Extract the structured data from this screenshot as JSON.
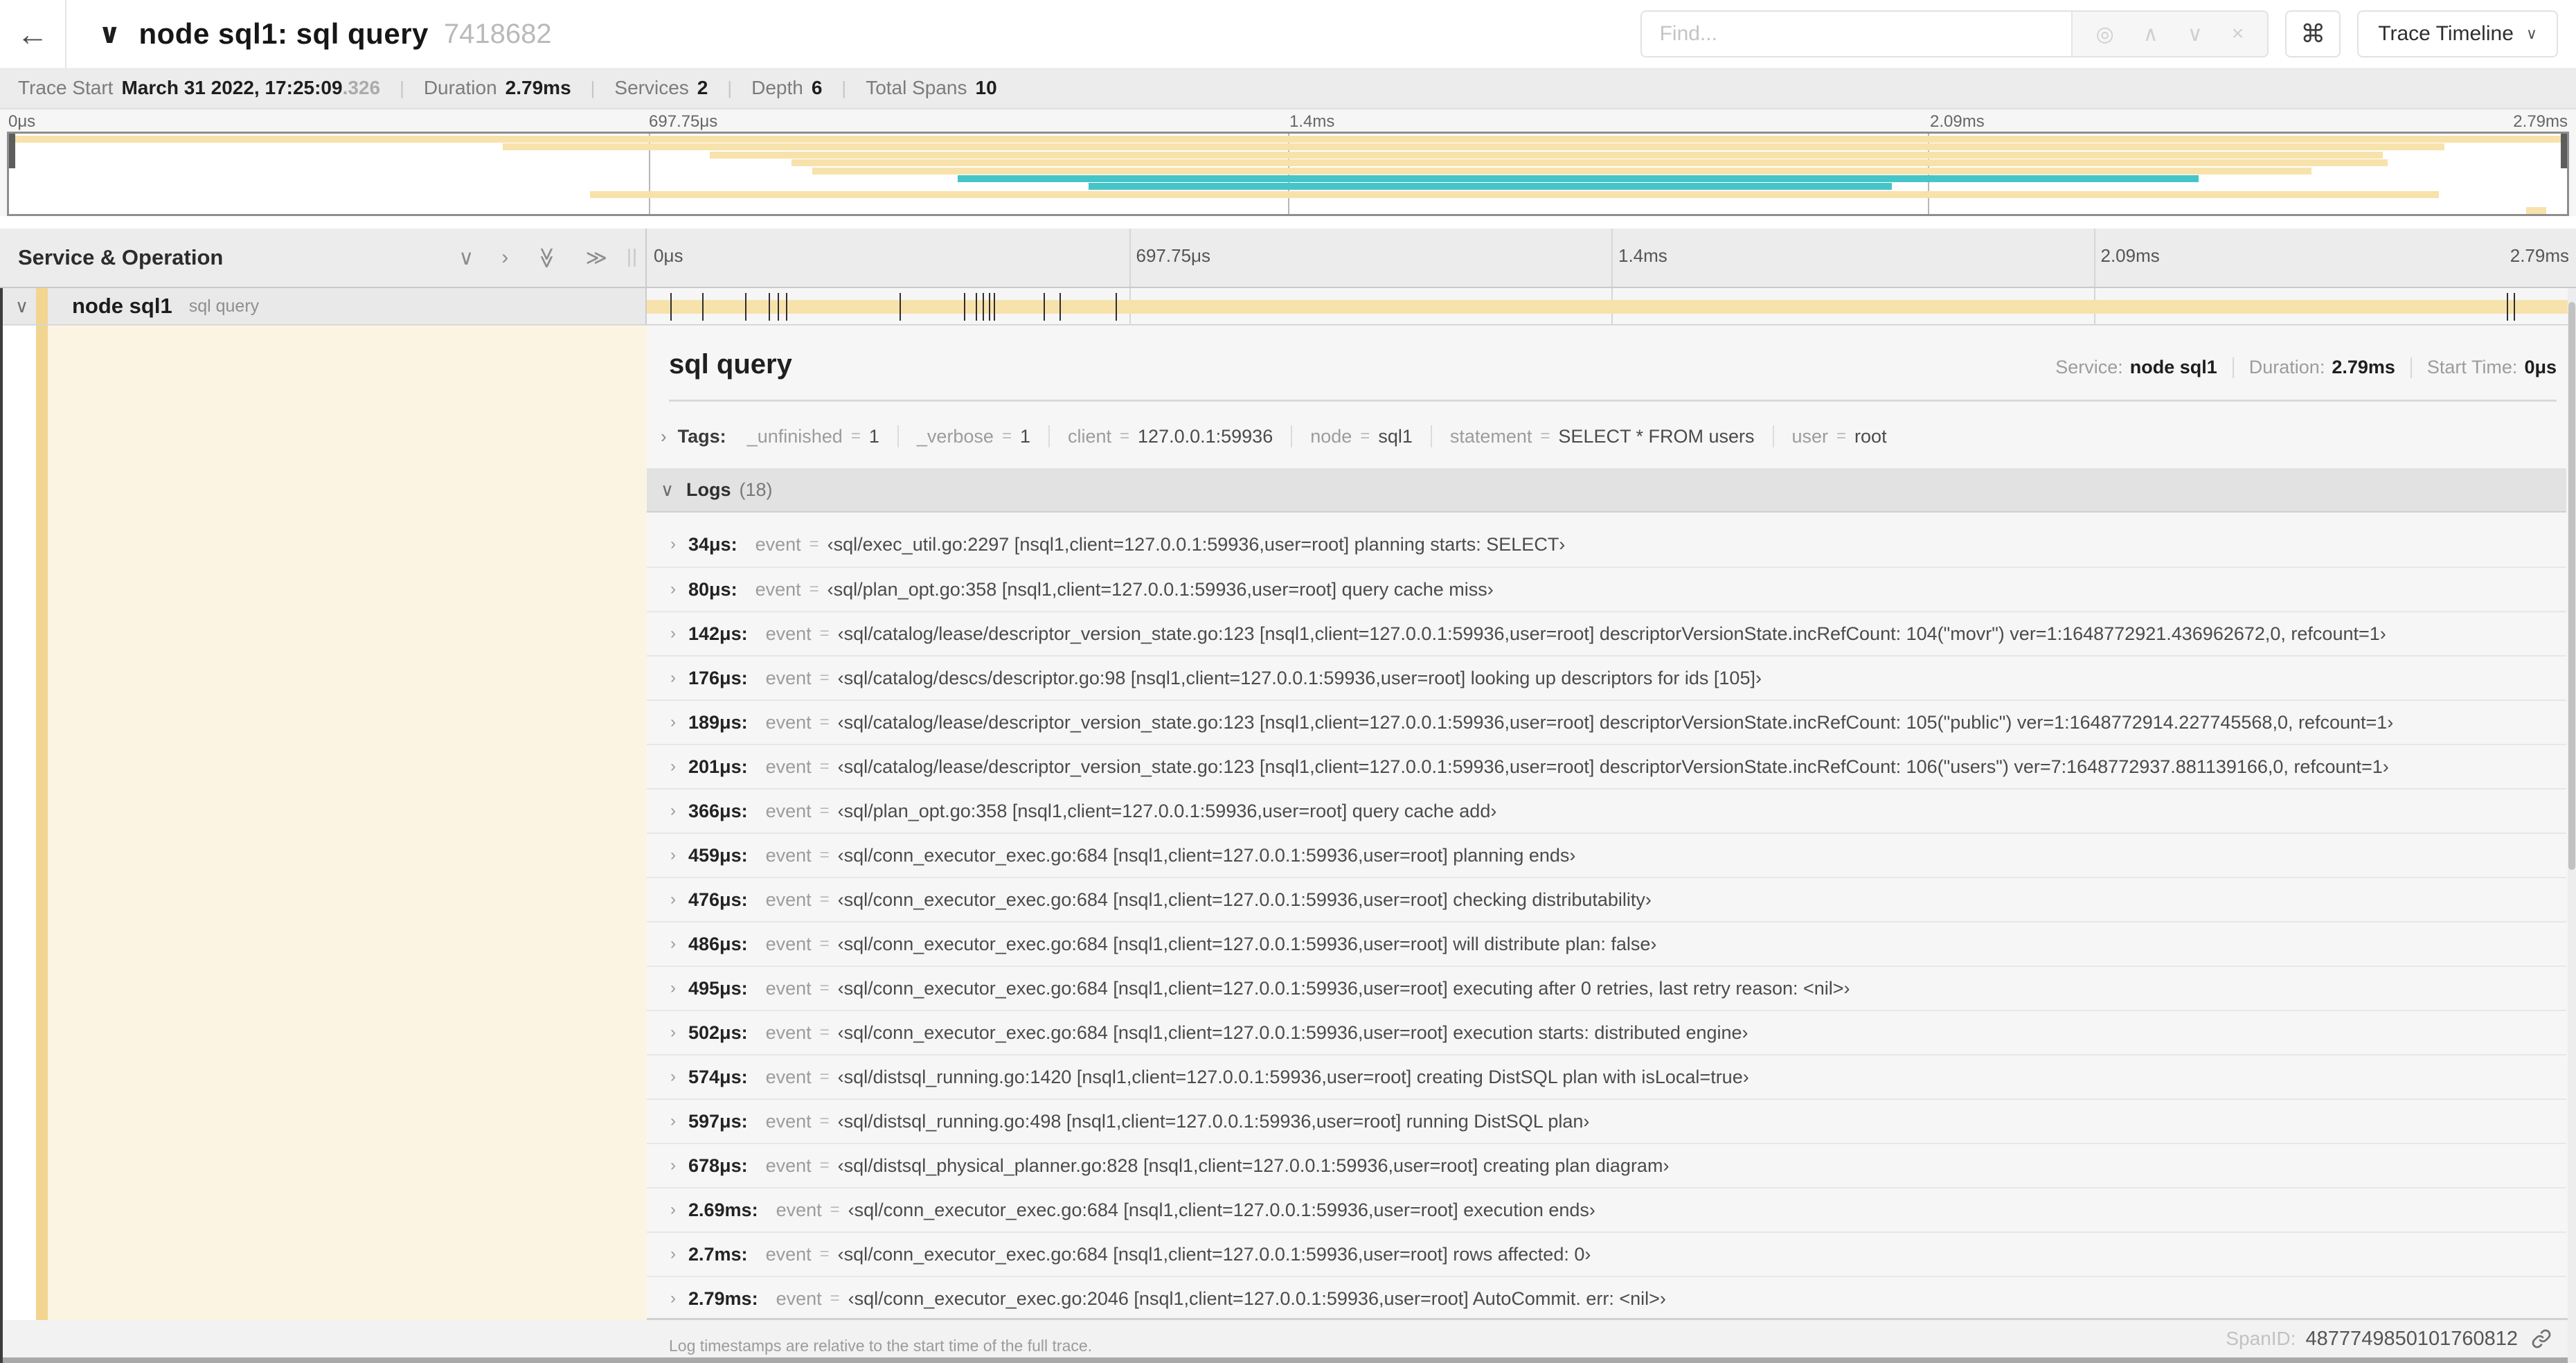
{
  "icons": {
    "back_arrow": "←",
    "chevron_down_bold": "∨",
    "chevron_down": "∨",
    "chevron_up": "∧",
    "chevron_right": "›",
    "double_chevron_right": "≫",
    "locate": "◎",
    "close": "×",
    "command": "⌘",
    "caret_down": "∨",
    "grip": "∥",
    "link": "link-chain"
  },
  "header": {
    "title": "node sql1: sql query",
    "trace_id": "7418682",
    "find_placeholder": "Find...",
    "shortcut_icon": "⌘",
    "view_button": "Trace Timeline"
  },
  "summary": {
    "items": [
      {
        "label": "Trace Start",
        "value": "March 31 2022, 17:25:09",
        "muted_suffix": ".326"
      },
      {
        "label": "Duration",
        "value": "2.79ms"
      },
      {
        "label": "Services",
        "value": "2"
      },
      {
        "label": "Depth",
        "value": "6"
      },
      {
        "label": "Total Spans",
        "value": "10"
      }
    ]
  },
  "timeline": {
    "left_title": "Service & Operation",
    "ticks": [
      "0μs",
      "697.75μs",
      "1.4ms",
      "2.09ms",
      "2.79ms"
    ],
    "tick_positions_pct": [
      0,
      25,
      50,
      75,
      100
    ]
  },
  "minimap": {
    "spans": [
      {
        "row": 0,
        "start_pct": 0,
        "end_pct": 100,
        "color": "tan"
      },
      {
        "row": 1,
        "start_pct": 19.3,
        "end_pct": 95.2,
        "color": "tan"
      },
      {
        "row": 2,
        "start_pct": 27.4,
        "end_pct": 92.8,
        "color": "tan"
      },
      {
        "row": 3,
        "start_pct": 30.6,
        "end_pct": 93.0,
        "color": "tan"
      },
      {
        "row": 4,
        "start_pct": 31.4,
        "end_pct": 90.0,
        "color": "tan"
      },
      {
        "row": 5,
        "start_pct": 37.1,
        "end_pct": 85.6,
        "color": "teal"
      },
      {
        "row": 6,
        "start_pct": 42.2,
        "end_pct": 73.6,
        "color": "teal"
      },
      {
        "row": 7,
        "start_pct": 22.7,
        "end_pct": 95.0,
        "color": "tan"
      },
      {
        "row": 9,
        "start_pct": 98.4,
        "end_pct": 99.2,
        "color": "tan"
      }
    ]
  },
  "span_row": {
    "service": "node sql1",
    "operation": "sql query",
    "total_us": 2790,
    "log_times_us": [
      34,
      80,
      142,
      176,
      189,
      201,
      366,
      459,
      476,
      486,
      495,
      502,
      574,
      597,
      678,
      2690,
      2700,
      2790
    ]
  },
  "detail": {
    "title": "sql query",
    "meta": {
      "service_label": "Service:",
      "service": "node sql1",
      "duration_label": "Duration:",
      "duration": "2.79ms",
      "start_label": "Start Time:",
      "start": "0μs"
    },
    "tags_label": "Tags:",
    "tags": [
      {
        "key": "_unfinished",
        "value": "1"
      },
      {
        "key": "_verbose",
        "value": "1"
      },
      {
        "key": "client",
        "value": "127.0.0.1:59936"
      },
      {
        "key": "node",
        "value": "sql1"
      },
      {
        "key": "statement",
        "value": "SELECT * FROM users"
      },
      {
        "key": "user",
        "value": "root"
      }
    ],
    "logs_label": "Logs",
    "logs_count": "(18)",
    "log_field_key": "event",
    "logs": [
      {
        "time": "34μs:",
        "message": "‹sql/exec_util.go:2297 [nsql1,client=127.0.0.1:59936,user=root] planning starts: SELECT›"
      },
      {
        "time": "80μs:",
        "message": "‹sql/plan_opt.go:358 [nsql1,client=127.0.0.1:59936,user=root] query cache miss›"
      },
      {
        "time": "142μs:",
        "message": "‹sql/catalog/lease/descriptor_version_state.go:123 [nsql1,client=127.0.0.1:59936,user=root] descriptorVersionState.incRefCount: 104(\"movr\") ver=1:1648772921.436962672,0, refcount=1›"
      },
      {
        "time": "176μs:",
        "message": "‹sql/catalog/descs/descriptor.go:98 [nsql1,client=127.0.0.1:59936,user=root] looking up descriptors for ids [105]›"
      },
      {
        "time": "189μs:",
        "message": "‹sql/catalog/lease/descriptor_version_state.go:123 [nsql1,client=127.0.0.1:59936,user=root] descriptorVersionState.incRefCount: 105(\"public\") ver=1:1648772914.227745568,0, refcount=1›"
      },
      {
        "time": "201μs:",
        "message": "‹sql/catalog/lease/descriptor_version_state.go:123 [nsql1,client=127.0.0.1:59936,user=root] descriptorVersionState.incRefCount: 106(\"users\") ver=7:1648772937.881139166,0, refcount=1›"
      },
      {
        "time": "366μs:",
        "message": "‹sql/plan_opt.go:358 [nsql1,client=127.0.0.1:59936,user=root] query cache add›"
      },
      {
        "time": "459μs:",
        "message": "‹sql/conn_executor_exec.go:684 [nsql1,client=127.0.0.1:59936,user=root] planning ends›"
      },
      {
        "time": "476μs:",
        "message": "‹sql/conn_executor_exec.go:684 [nsql1,client=127.0.0.1:59936,user=root] checking distributability›"
      },
      {
        "time": "486μs:",
        "message": "‹sql/conn_executor_exec.go:684 [nsql1,client=127.0.0.1:59936,user=root] will distribute plan: false›"
      },
      {
        "time": "495μs:",
        "message": "‹sql/conn_executor_exec.go:684 [nsql1,client=127.0.0.1:59936,user=root] executing after 0 retries, last retry reason: <nil>›"
      },
      {
        "time": "502μs:",
        "message": "‹sql/conn_executor_exec.go:684 [nsql1,client=127.0.0.1:59936,user=root] execution starts: distributed engine›"
      },
      {
        "time": "574μs:",
        "message": "‹sql/distsql_running.go:1420 [nsql1,client=127.0.0.1:59936,user=root] creating DistSQL plan with isLocal=true›"
      },
      {
        "time": "597μs:",
        "message": "‹sql/distsql_running.go:498 [nsql1,client=127.0.0.1:59936,user=root] running DistSQL plan›"
      },
      {
        "time": "678μs:",
        "message": "‹sql/distsql_physical_planner.go:828 [nsql1,client=127.0.0.1:59936,user=root] creating plan diagram›"
      },
      {
        "time": "2.69ms:",
        "message": "‹sql/conn_executor_exec.go:684 [nsql1,client=127.0.0.1:59936,user=root] execution ends›"
      },
      {
        "time": "2.7ms:",
        "message": "‹sql/conn_executor_exec.go:684 [nsql1,client=127.0.0.1:59936,user=root] rows affected: 0›"
      },
      {
        "time": "2.79ms:",
        "message": "‹sql/conn_executor_exec.go:2046 [nsql1,client=127.0.0.1:59936,user=root] AutoCommit. err: <nil>›"
      }
    ],
    "footnote": "Log timestamps are relative to the start time of the full trace.",
    "spanid_label": "SpanID:",
    "spanid": "4877749850101760812"
  },
  "colors": {
    "tan_bar": "#F8E2AC",
    "tan_stripe": "#F2D591",
    "teal_bar": "#45C5C8",
    "cream_panel": "#FCF4E2",
    "selected_row_bg": "#e9e9e9",
    "logs_header_bg": "#e2e2e2"
  }
}
